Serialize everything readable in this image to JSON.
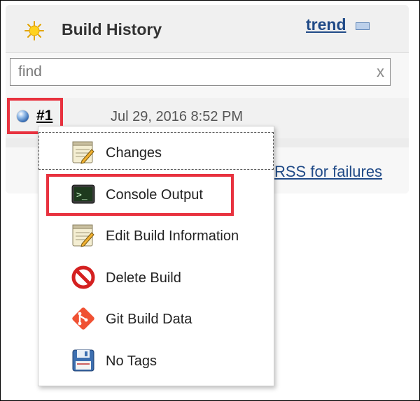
{
  "panel": {
    "title": "Build History",
    "trend_label": "trend"
  },
  "search": {
    "placeholder": "find",
    "clear_label": "x"
  },
  "build": {
    "number": "#1",
    "timestamp": "Jul 29, 2016 8:52 PM",
    "status_color": "#3a6fb5"
  },
  "rss": {
    "failures_label": "RSS for failures"
  },
  "menu": {
    "items": [
      {
        "label": "Changes",
        "icon": "notepad-icon"
      },
      {
        "label": "Console Output",
        "icon": "terminal-icon"
      },
      {
        "label": "Edit Build Information",
        "icon": "notepad-icon"
      },
      {
        "label": "Delete Build",
        "icon": "no-entry-icon"
      },
      {
        "label": "Git Build Data",
        "icon": "git-icon"
      },
      {
        "label": "No Tags",
        "icon": "floppy-disk-icon"
      }
    ]
  },
  "colors": {
    "highlight": "#e8323f",
    "link": "#204a87"
  }
}
